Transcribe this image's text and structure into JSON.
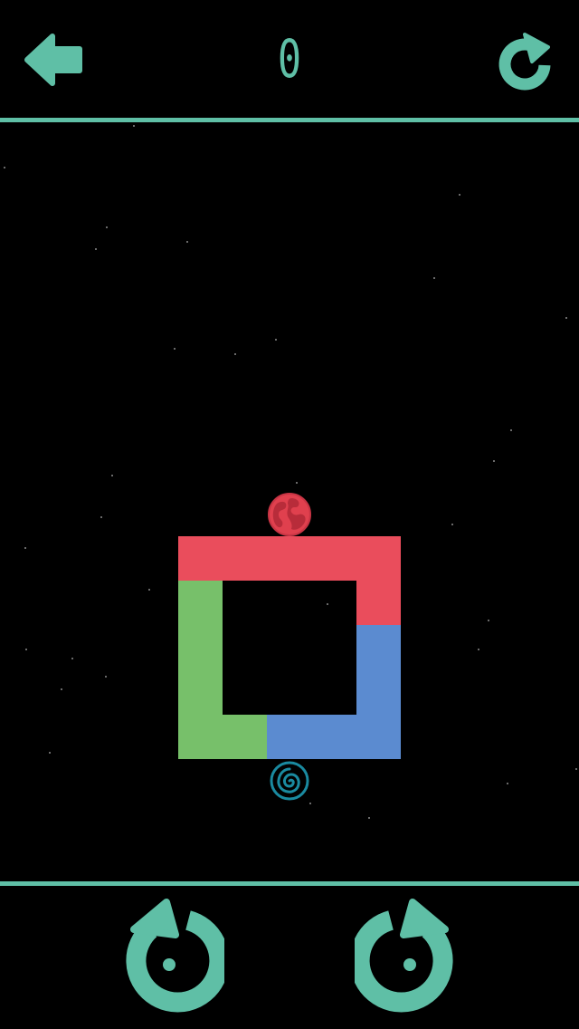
{
  "colors": {
    "accent": "#5fbfa6",
    "background": "#000000",
    "red": "#ea4d5c",
    "green": "#77c06a",
    "blue": "#5b8bd0",
    "spiral": "#1a8aa0",
    "earth": "#e0404e"
  },
  "header": {
    "back_icon": "arrow-left-icon",
    "score": "0",
    "restart_icon": "restart-icon"
  },
  "board": {
    "segments": [
      "red",
      "red",
      "blue",
      "blue",
      "green",
      "green"
    ]
  },
  "balls": {
    "top": "earth-icon",
    "bottom": "spiral-icon"
  },
  "controls": {
    "rotate_left_icon": "rotate-counterclockwise-icon",
    "rotate_right_icon": "rotate-clockwise-icon"
  }
}
